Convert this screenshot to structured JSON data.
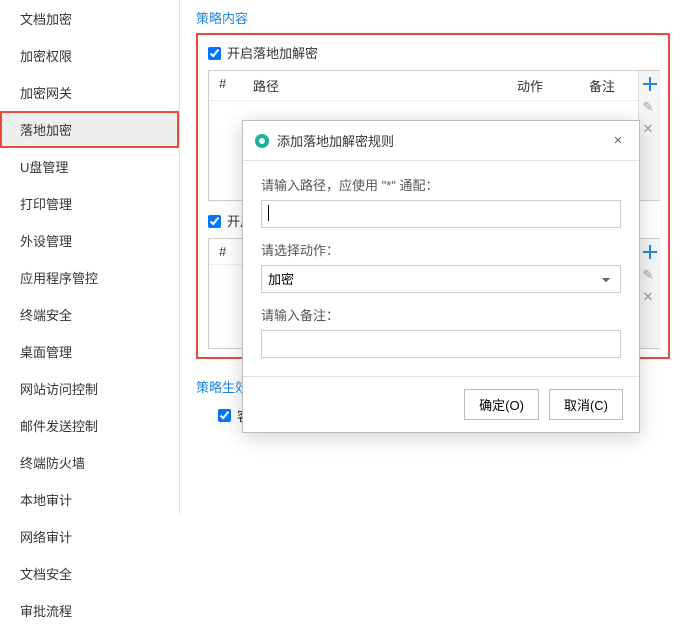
{
  "sidebar": {
    "items": [
      {
        "label": "文档加密"
      },
      {
        "label": "加密权限"
      },
      {
        "label": "加密网关"
      },
      {
        "label": "落地加密",
        "active": true
      },
      {
        "label": "U盘管理"
      },
      {
        "label": "打印管理"
      },
      {
        "label": "外设管理"
      },
      {
        "label": "应用程序管控"
      },
      {
        "label": "终端安全"
      },
      {
        "label": "桌面管理"
      },
      {
        "label": "网站访问控制"
      },
      {
        "label": "邮件发送控制"
      },
      {
        "label": "终端防火墙"
      },
      {
        "label": "本地审计"
      },
      {
        "label": "网络审计"
      },
      {
        "label": "文档安全"
      },
      {
        "label": "审批流程"
      }
    ]
  },
  "main": {
    "section_title": "策略内容",
    "block1": {
      "checkbox_label": "开启落地加解密",
      "checked": true,
      "th_hash": "#",
      "th_path": "路径",
      "th_action": "动作",
      "th_remark": "备注"
    },
    "block2": {
      "checkbox_label_prefix": "开启",
      "checked": true,
      "th_hash": "#"
    },
    "status_title": "策略生效状态",
    "status_checkbox": "客户端在线时生效",
    "status_checked": true
  },
  "modal": {
    "title": "添加落地加解密规则",
    "label_path": "请输入路径，应使用 \"*\" 通配：",
    "label_action": "请选择动作：",
    "label_remark": "请输入备注：",
    "action_value": "加密",
    "ok": "确定(O)",
    "cancel": "取消(C)"
  }
}
